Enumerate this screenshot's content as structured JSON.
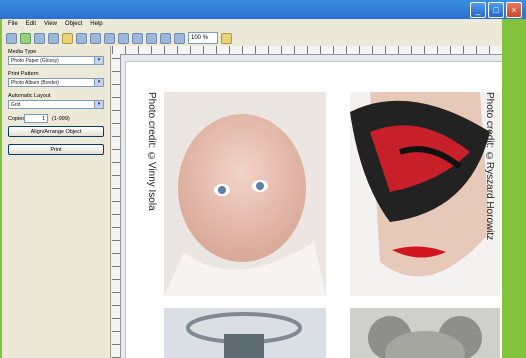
{
  "menu": [
    "File",
    "Edit",
    "View",
    "Object",
    "Help"
  ],
  "toolbar": {
    "zoom": "100 %"
  },
  "sidebar": {
    "media_type_label": "Media Type",
    "media_type_value": "Photo Paper (Glossy)",
    "print_pattern_label": "Print Pattern",
    "print_pattern_value": "Photo Album (Border)",
    "automatic_layout_label": "Automatic Layout",
    "automatic_layout_value": "Grid",
    "copies_label": "Copies",
    "copies_value": "1",
    "copies_range": "(1-999)",
    "align_button": "Align/Arrange Object",
    "print_button": "Print"
  },
  "credits": {
    "left": "Photo credit: ©Vinny Isola",
    "right": "Photo credit: ©Ryszard Horowitz"
  }
}
